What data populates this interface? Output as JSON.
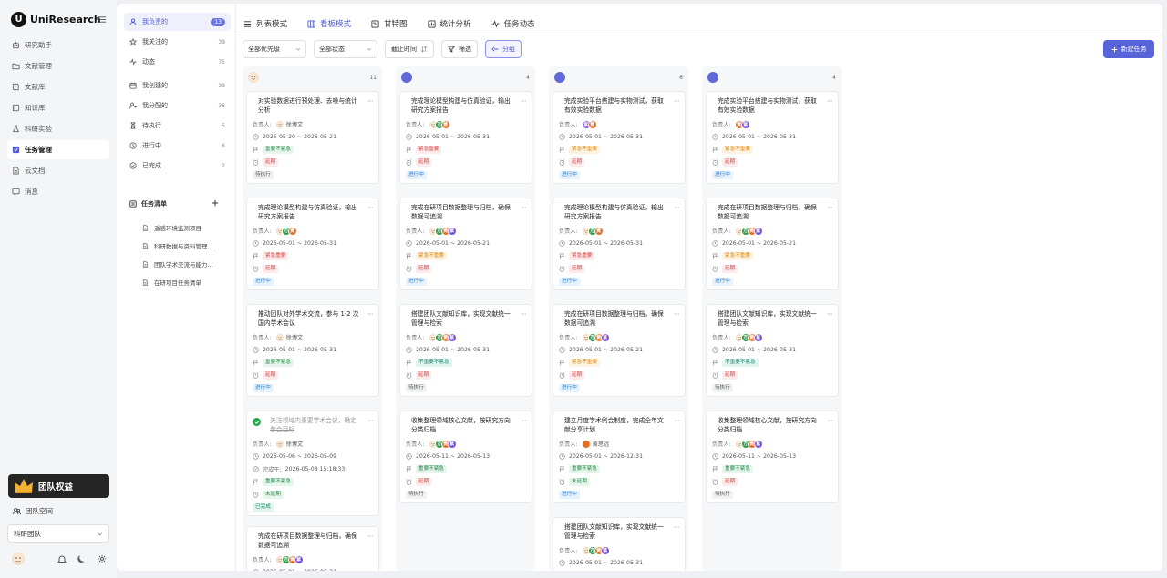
{
  "app": {
    "logo_mark": "U",
    "name": "UniResearch"
  },
  "nav": [
    {
      "label": "研究助手",
      "icon": "robot-icon"
    },
    {
      "label": "文献管理",
      "icon": "folder-icon"
    },
    {
      "label": "文献库",
      "icon": "book-icon"
    },
    {
      "label": "知识库",
      "icon": "library-icon"
    },
    {
      "label": "科研实验",
      "icon": "flask-icon"
    },
    {
      "label": "任务管理",
      "icon": "task-icon",
      "active": true
    },
    {
      "label": "云文档",
      "icon": "cloud-doc-icon"
    },
    {
      "label": "消息",
      "icon": "message-icon"
    }
  ],
  "vip": {
    "label": "团队权益"
  },
  "team": {
    "space_label": "团队空间",
    "selected": "科研团队"
  },
  "subnav": [
    {
      "label": "我负责的",
      "count": "13",
      "icon": "user-icon",
      "active": true
    },
    {
      "label": "我关注的",
      "count": "39",
      "icon": "star-icon"
    },
    {
      "label": "动态",
      "count": "75",
      "icon": "activity-icon"
    },
    {
      "label": "我创建的",
      "count": "39",
      "icon": "calendar-icon"
    },
    {
      "label": "我分配的",
      "count": "36",
      "icon": "assign-icon"
    },
    {
      "label": "待执行",
      "count": "5",
      "icon": "hourglass-icon"
    },
    {
      "label": "进行中",
      "count": "6",
      "icon": "progress-icon"
    },
    {
      "label": "已完成",
      "count": "2",
      "icon": "check-circle-icon"
    }
  ],
  "tasklists": {
    "title": "任务清单",
    "items": [
      "遥感环境监测项目",
      "科研数据与资料管理...",
      "团队学术交流与能力...",
      "在研项目任务清单"
    ]
  },
  "tabs": [
    "列表模式",
    "看板模式",
    "甘特图",
    "统计分析",
    "任务动态"
  ],
  "filters": {
    "priority": "全部优先级",
    "status": "全部状态",
    "deadline": "截止时间",
    "filter": "筛选",
    "group": "分组",
    "new_task": "新建任务"
  },
  "labels": {
    "owner": "负责人:",
    "completed_at": "完成于:"
  },
  "columns": [
    {
      "count": "11",
      "cards": [
        {
          "title": "对实验数据进行预处理、去噪与统计分析",
          "owners": [
            "徐博文"
          ],
          "date": "2026-05-20 ~ 2026-05-21",
          "priority": "重要不紧急",
          "delay": "延期",
          "status": "待执行"
        },
        {
          "title": "完成理论模型构建与仿真验证，输出研究方案报告",
          "owners": [
            "A",
            "方",
            "黄"
          ],
          "date": "2026-05-01 ~ 2026-05-31",
          "priority": "紧急重要",
          "delay": "延期",
          "status": "进行中"
        },
        {
          "title": "推动团队对外学术交流，参与 1-2 次国内学术会议",
          "owners": [
            "徐博文"
          ],
          "date": "2026-05-01 ~ 2026-05-31",
          "priority": "重要不紧急",
          "delay": "延期",
          "status": "进行中"
        },
        {
          "title": "关注领域内重要学术会议，确定参会目标",
          "done": true,
          "owners": [
            "徐博文"
          ],
          "date": "2026-05-06 ~ 2026-05-09",
          "completed": "2026-05-08 15:18:33",
          "priority": "重要不紧急",
          "delay": "未延期",
          "status": "已完成"
        },
        {
          "title": "完成在研项目数据整理与归档，确保数据可追溯",
          "owners": [
            "A",
            "方",
            "黄",
            "紫"
          ],
          "date": "2026-05-01 ~ 2026-05-31",
          "priority": "",
          "delay": "",
          "status": ""
        }
      ]
    },
    {
      "count": "4",
      "cards": [
        {
          "title": "完成理论模型构建与仿真验证，输出研究方案报告",
          "owners": [
            "A",
            "方",
            "黄"
          ],
          "date": "2026-05-01 ~ 2026-05-31",
          "priority": "紧急重要",
          "delay": "延期",
          "status": "进行中"
        },
        {
          "title": "完成在研项目数据整理与归档，确保数据可追溯",
          "owners": [
            "A",
            "方",
            "黄",
            "紫"
          ],
          "date": "2026-05-01 ~ 2026-05-21",
          "priority": "紧急不重要",
          "delay": "延期",
          "status": "进行中"
        },
        {
          "title": "搭建团队文献知识库，实现文献统一管理与检索",
          "owners": [
            "A",
            "方",
            "黄",
            "紫"
          ],
          "date": "2026-05-01 ~ 2026-05-31",
          "priority": "不重要不紧急",
          "delay": "延期",
          "status": "待执行"
        },
        {
          "title": "收集整理领域核心文献，按研究方向分类归档",
          "owners": [
            "A",
            "方",
            "黄",
            "紫"
          ],
          "date": "2026-05-11 ~ 2026-05-13",
          "priority": "重要不紧急",
          "delay": "延期",
          "status": "待执行"
        }
      ]
    },
    {
      "count": "6",
      "cards": [
        {
          "title": "完成实验平台搭建与实物测试，获取有效实验数据",
          "owners": [
            "紫",
            "黄"
          ],
          "date": "2026-05-01 ~ 2026-05-31",
          "priority": "紧急不重要",
          "delay": "延期",
          "status": "进行中"
        },
        {
          "title": "完成理论模型构建与仿真验证，输出研究方案报告",
          "owners": [
            "A",
            "方",
            "黄"
          ],
          "date": "2026-05-01 ~ 2026-05-31",
          "priority": "紧急重要",
          "delay": "延期",
          "status": "进行中"
        },
        {
          "title": "完成在研项目数据整理与归档，确保数据可追溯",
          "owners": [
            "A",
            "方",
            "黄",
            "紫"
          ],
          "date": "2026-05-01 ~ 2026-05-21",
          "priority": "紧急不重要",
          "delay": "延期",
          "status": "进行中"
        },
        {
          "title": "建立月度学术例会制度，完成全年文献分享计划",
          "owners": [
            "黄思远"
          ],
          "date": "2026-05-01 ~ 2026-12-31",
          "priority": "重要不紧急",
          "delay": "未延期",
          "status": "进行中"
        },
        {
          "title": "搭建团队文献知识库，实现文献统一管理与检索",
          "owners": [
            "A",
            "方",
            "黄",
            "紫"
          ],
          "date": "2026-05-01 ~ 2026-05-31",
          "priority": "",
          "delay": "",
          "status": ""
        }
      ]
    },
    {
      "count": "4",
      "cards": [
        {
          "title": "完成实验平台搭建与实物测试，获取有效实验数据",
          "owners": [
            "黄",
            "紫"
          ],
          "date": "2026-05-01 ~ 2026-05-31",
          "priority": "紧急不重要",
          "delay": "延期",
          "status": "进行中"
        },
        {
          "title": "完成在研项目数据整理与归档，确保数据可追溯",
          "owners": [
            "A",
            "方",
            "黄",
            "紫"
          ],
          "date": "2026-05-01 ~ 2026-05-21",
          "priority": "紧急不重要",
          "delay": "延期",
          "status": "进行中"
        },
        {
          "title": "搭建团队文献知识库，实现文献统一管理与检索",
          "owners": [
            "A",
            "方",
            "黄",
            "紫"
          ],
          "date": "2026-05-01 ~ 2026-05-31",
          "priority": "不重要不紧急",
          "delay": "延期",
          "status": "待执行"
        },
        {
          "title": "收集整理领域核心文献，按研究方向分类归档",
          "owners": [
            "A",
            "方",
            "黄",
            "紫"
          ],
          "date": "2026-05-11 ~ 2026-05-13",
          "priority": "重要不紧急",
          "delay": "延期",
          "status": "待执行"
        }
      ]
    }
  ]
}
